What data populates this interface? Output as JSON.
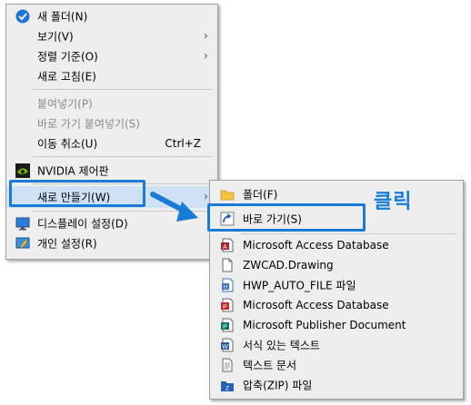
{
  "context_menu": {
    "items": [
      {
        "label": "새 폴더(N)",
        "icon": "new-folder-blue-icon"
      },
      {
        "label": "보기(V)",
        "submenu": true
      },
      {
        "label": "정렬 기준(O)",
        "submenu": true
      },
      {
        "label": "새로 고침(E)"
      },
      {
        "label": "붙여넣기(P)",
        "disabled": true
      },
      {
        "label": "바로 가기 붙여넣기(S)",
        "disabled": true
      },
      {
        "label": "이동 취소(U)",
        "accelerator": "Ctrl+Z"
      },
      {
        "label": "NVIDIA 제어판",
        "icon": "nvidia-icon"
      },
      {
        "label": "새로 만들기(W)",
        "submenu": true,
        "highlighted": true
      },
      {
        "label": "디스플레이 설정(D)",
        "icon": "display-icon"
      },
      {
        "label": "개인 설정(R)",
        "icon": "personalize-icon"
      }
    ]
  },
  "new_submenu": {
    "items": [
      {
        "label": "폴더(F)",
        "icon": "folder-icon"
      },
      {
        "label": "바로 가기(S)",
        "icon": "shortcut-icon",
        "highlighted": true
      },
      {
        "label": "Microsoft Access Database",
        "icon": "access-icon"
      },
      {
        "label": "ZWCAD.Drawing",
        "icon": "blank-file-icon"
      },
      {
        "label": "HWP_AUTO_FILE 파일",
        "icon": "hwp-icon"
      },
      {
        "label": "Microsoft Access Database",
        "icon": "access-pdf-icon"
      },
      {
        "label": "Microsoft Publisher Document",
        "icon": "publisher-icon"
      },
      {
        "label": "서식 있는 텍스트",
        "icon": "rtf-icon"
      },
      {
        "label": "텍스트 문서",
        "icon": "text-file-icon"
      },
      {
        "label": "압축(ZIP) 파일",
        "icon": "zip-icon"
      }
    ]
  },
  "annotation": {
    "callout_text": "클릭",
    "accent": "#1a7bd6"
  }
}
